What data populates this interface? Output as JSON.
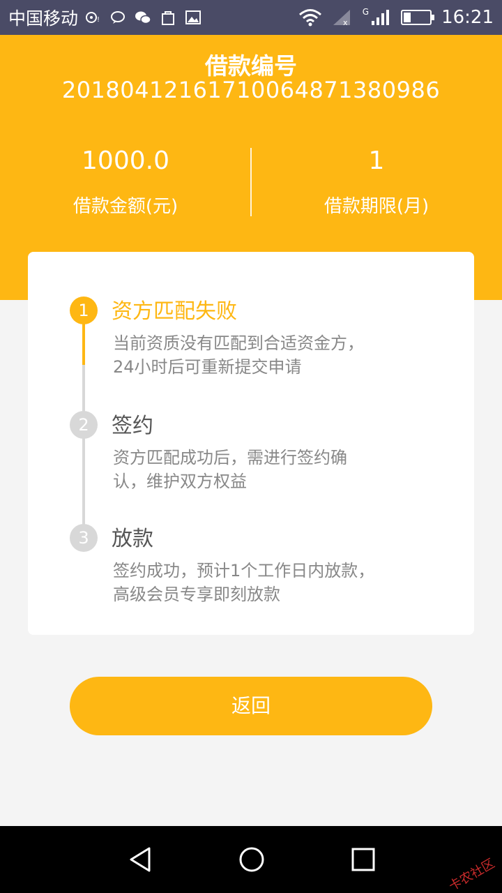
{
  "status_bar": {
    "carrier": "中国移动",
    "network_label": "G",
    "time": "16:21"
  },
  "header": {
    "loan_no_title": "借款编号",
    "loan_no": "201804121617100648713 80986",
    "amount_value": "1000.0",
    "amount_label": "借款金额(元)",
    "term_value": "1",
    "term_label": "借款期限(月)"
  },
  "steps": [
    {
      "num": "1",
      "title": "资方匹配失败",
      "desc_line1": "当前资质没有匹配到合适资金方，",
      "desc_line2": "24小时后可重新提交申请"
    },
    {
      "num": "2",
      "title": "签约",
      "desc_line1": "资方匹配成功后，需进行签约确",
      "desc_line2": "认，维护双方权益"
    },
    {
      "num": "3",
      "title": "放款",
      "desc_line1": "签约成功，预计1个工作日内放款，",
      "desc_line2": "高级会员专享即刻放款"
    }
  ],
  "actions": {
    "return_label": "返回"
  },
  "watermark": "卡农社区",
  "colors": {
    "accent": "#feb713",
    "inactive": "#d8d8d8",
    "status_bar": "#4a4b66"
  },
  "icons": [
    "wifi-icon",
    "signal-icon",
    "battery-icon",
    "nav-back-icon",
    "nav-home-icon",
    "nav-recents-icon"
  ]
}
